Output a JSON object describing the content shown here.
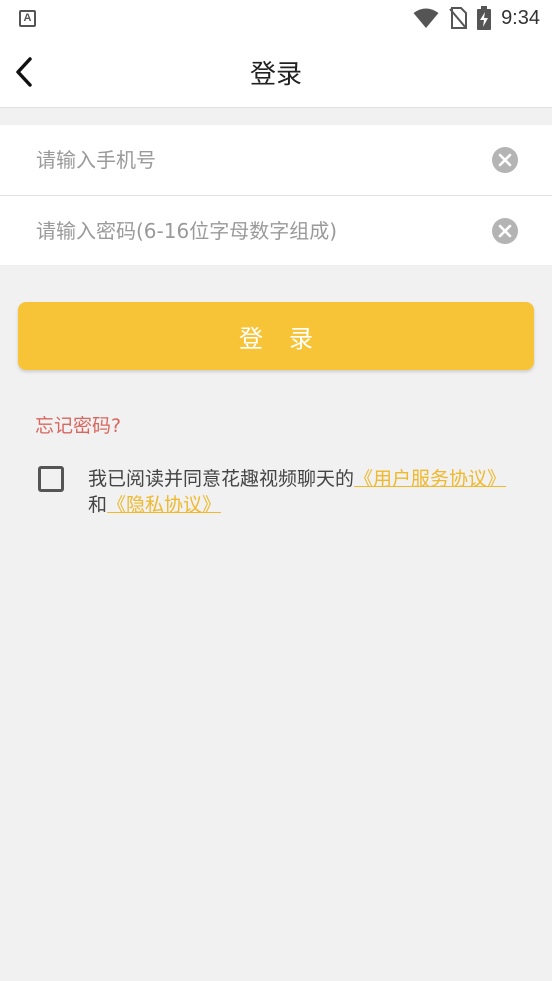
{
  "status_bar": {
    "left_icon": "A",
    "time": "9:34",
    "icons": [
      "wifi-icon",
      "no-sim-icon",
      "battery-charging-icon"
    ]
  },
  "header": {
    "back_icon": "chevron-left-icon",
    "title": "登录"
  },
  "form": {
    "phone": {
      "value": "",
      "placeholder": "请输入手机号"
    },
    "password": {
      "value": "",
      "placeholder": "请输入密码(6-16位字母数字组成)"
    },
    "clear_icon": "clear-circle-icon"
  },
  "login_button": {
    "label": "登录"
  },
  "forgot_password": "忘记密码?",
  "agreement": {
    "checked": false,
    "prefix": "我已阅读并同意花趣视频聊天的",
    "user_agreement": "《用户服务协议》",
    "connector": "和",
    "privacy_agreement": "《隐私协议》"
  },
  "colors": {
    "accent": "#f8c437",
    "link": "#f0b92c",
    "forgot": "#d9675f",
    "background": "#f1f1f1"
  }
}
